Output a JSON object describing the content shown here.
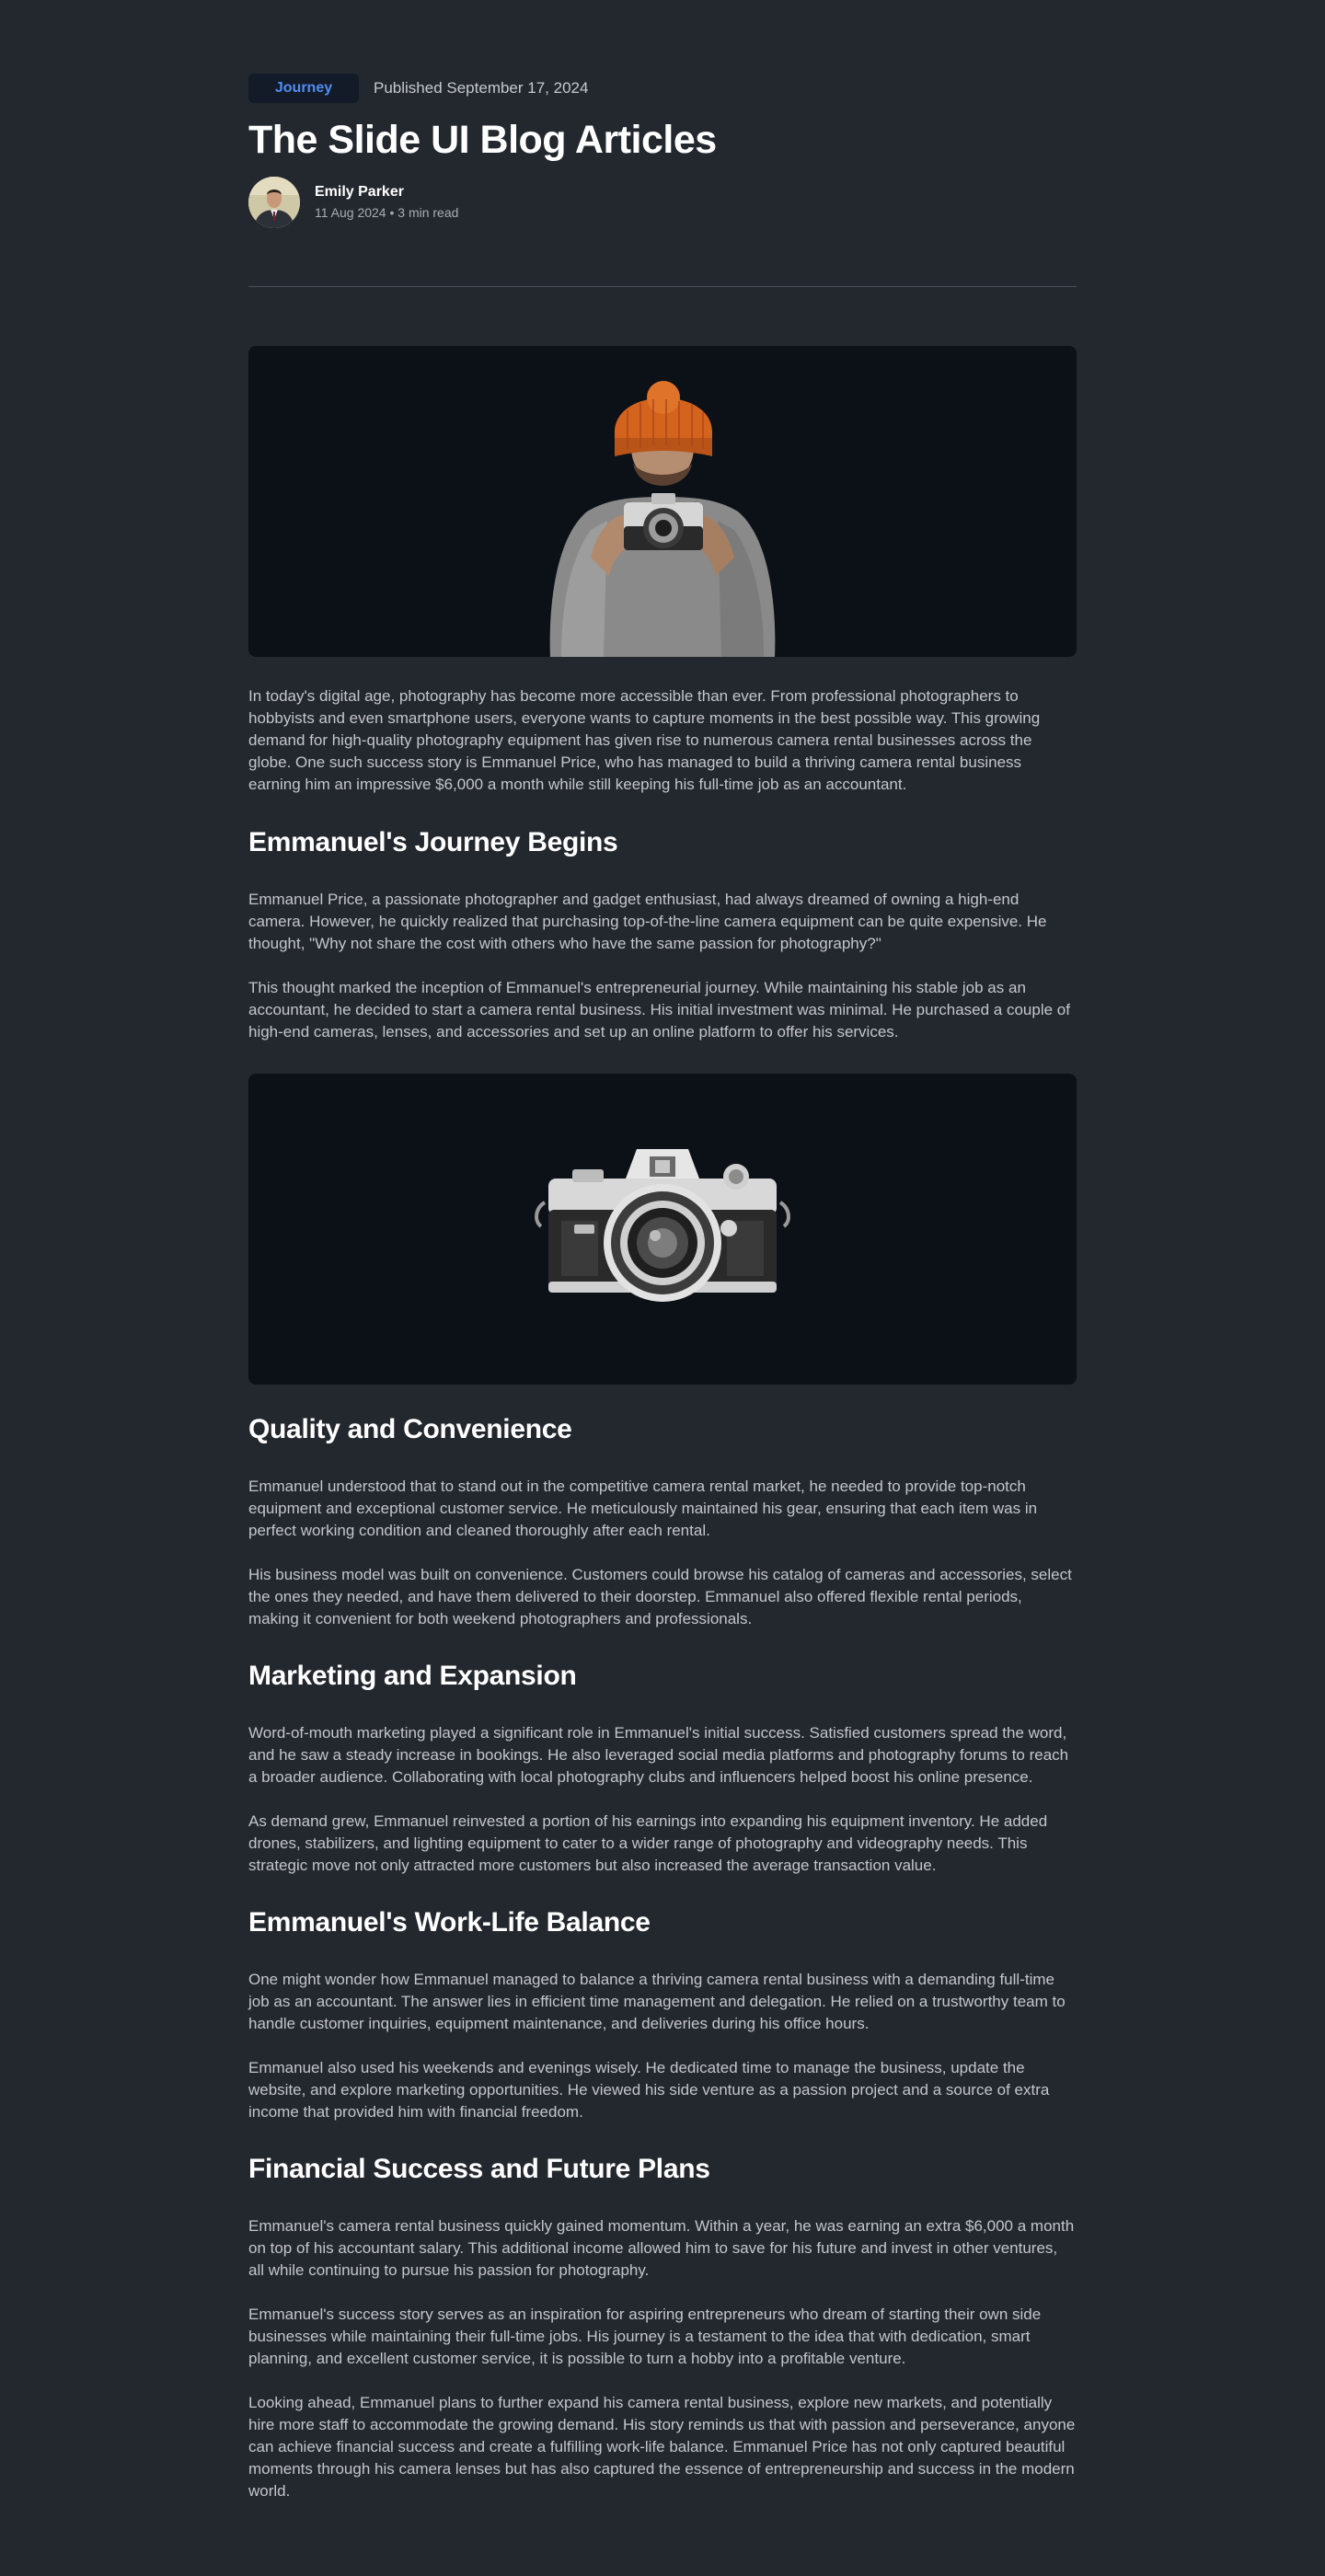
{
  "header": {
    "tag": "Journey",
    "published": "Published September 17, 2024",
    "title": "The Slide UI Blog Articles"
  },
  "author": {
    "name": "Emily Parker",
    "meta": "11 Aug 2024 • 3 min read"
  },
  "images": {
    "hero": "photographer-with-camera-image",
    "camera": "vintage-camera-image"
  },
  "content": {
    "intro": "In today's digital age, photography has become more accessible than ever. From professional photographers to hobbyists and even smartphone users, everyone wants to capture moments in the best possible way. This growing demand for high-quality photography equipment has given rise to numerous camera rental businesses across the globe. One such success story is Emmanuel Price, who has managed to build a thriving camera rental business earning him an impressive $6,000 a month while still keeping his full-time job as an accountant.",
    "section1": {
      "heading": "Emmanuel's Journey Begins",
      "p1": "Emmanuel Price, a passionate photographer and gadget enthusiast, had always dreamed of owning a high-end camera. However, he quickly realized that purchasing top-of-the-line camera equipment can be quite expensive. He thought, \"Why not share the cost with others who have the same passion for photography?\"",
      "p2": "This thought marked the inception of Emmanuel's entrepreneurial journey. While maintaining his stable job as an accountant, he decided to start a camera rental business. His initial investment was minimal. He purchased a couple of high-end cameras, lenses, and accessories and set up an online platform to offer his services."
    },
    "section2": {
      "heading": "Quality and Convenience",
      "p1": "Emmanuel understood that to stand out in the competitive camera rental market, he needed to provide top-notch equipment and exceptional customer service. He meticulously maintained his gear, ensuring that each item was in perfect working condition and cleaned thoroughly after each rental.",
      "p2": "His business model was built on convenience. Customers could browse his catalog of cameras and accessories, select the ones they needed, and have them delivered to their doorstep. Emmanuel also offered flexible rental periods, making it convenient for both weekend photographers and professionals."
    },
    "section3": {
      "heading": "Marketing and Expansion",
      "p1": "Word-of-mouth marketing played a significant role in Emmanuel's initial success. Satisfied customers spread the word, and he saw a steady increase in bookings. He also leveraged social media platforms and photography forums to reach a broader audience. Collaborating with local photography clubs and influencers helped boost his online presence.",
      "p2": "As demand grew, Emmanuel reinvested a portion of his earnings into expanding his equipment inventory. He added drones, stabilizers, and lighting equipment to cater to a wider range of photography and videography needs. This strategic move not only attracted more customers but also increased the average transaction value."
    },
    "section4": {
      "heading": "Emmanuel's Work-Life Balance",
      "p1": "One might wonder how Emmanuel managed to balance a thriving camera rental business with a demanding full-time job as an accountant. The answer lies in efficient time management and delegation. He relied on a trustworthy team to handle customer inquiries, equipment maintenance, and deliveries during his office hours.",
      "p2": "Emmanuel also used his weekends and evenings wisely. He dedicated time to manage the business, update the website, and explore marketing opportunities. He viewed his side venture as a passion project and a source of extra income that provided him with financial freedom."
    },
    "section5": {
      "heading": "Financial Success and Future Plans",
      "p1": "Emmanuel's camera rental business quickly gained momentum. Within a year, he was earning an extra $6,000 a month on top of his accountant salary. This additional income allowed him to save for his future and invest in other ventures, all while continuing to pursue his passion for photography.",
      "p2": "Emmanuel's success story serves as an inspiration for aspiring entrepreneurs who dream of starting their own side businesses while maintaining their full-time jobs. His journey is a testament to the idea that with dedication, smart planning, and excellent customer service, it is possible to turn a hobby into a profitable venture.",
      "p3": "Looking ahead, Emmanuel plans to further expand his camera rental business, explore new markets, and potentially hire more staff to accommodate the growing demand. His story reminds us that with passion and perseverance, anyone can achieve financial success and create a fulfilling work-life balance. Emmanuel Price has not only captured beautiful moments through his camera lenses but has also captured the essence of entrepreneurship and success in the modern world."
    }
  }
}
